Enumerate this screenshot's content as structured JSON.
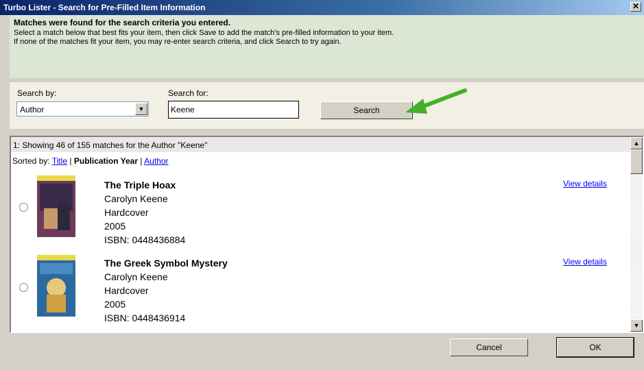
{
  "window": {
    "title": "Turbo Lister - Search for Pre-Filled Item Information",
    "close_glyph": "✕"
  },
  "header": {
    "title": "Matches were found for the search criteria you entered.",
    "line1": "Select a match below that best fits your item, then click Save to add the match's pre-filled information to your item.",
    "line2": "If none of the matches fit your item, you may re-enter search criteria, and click Search to try again."
  },
  "search": {
    "by_label": "Search by:",
    "by_value": "Author",
    "for_label": "Search for:",
    "for_value": "Keene",
    "button_label": "Search",
    "arrow_color": "#44b02a"
  },
  "results": {
    "summary": "1: Showing 46 of 155 matches for the Author \"Keene\"",
    "sort_label": "Sorted by:",
    "sort_title": "Title",
    "sort_year": "Publication Year",
    "sort_author": "Author",
    "sep": "|",
    "items": [
      {
        "title": "The Triple Hoax",
        "author": "Carolyn Keene",
        "format": "Hardcover",
        "year": "2005",
        "isbn": "ISBN: 0448436884",
        "link": "View details",
        "cover_color": "#6e3a5a"
      },
      {
        "title": "The Greek Symbol Mystery",
        "author": "Carolyn Keene",
        "format": "Hardcover",
        "year": "2005",
        "isbn": "ISBN: 0448436914",
        "link": "View details",
        "cover_color": "#2a6aa0"
      }
    ]
  },
  "footer": {
    "cancel_label": "Cancel",
    "ok_label": "OK"
  }
}
